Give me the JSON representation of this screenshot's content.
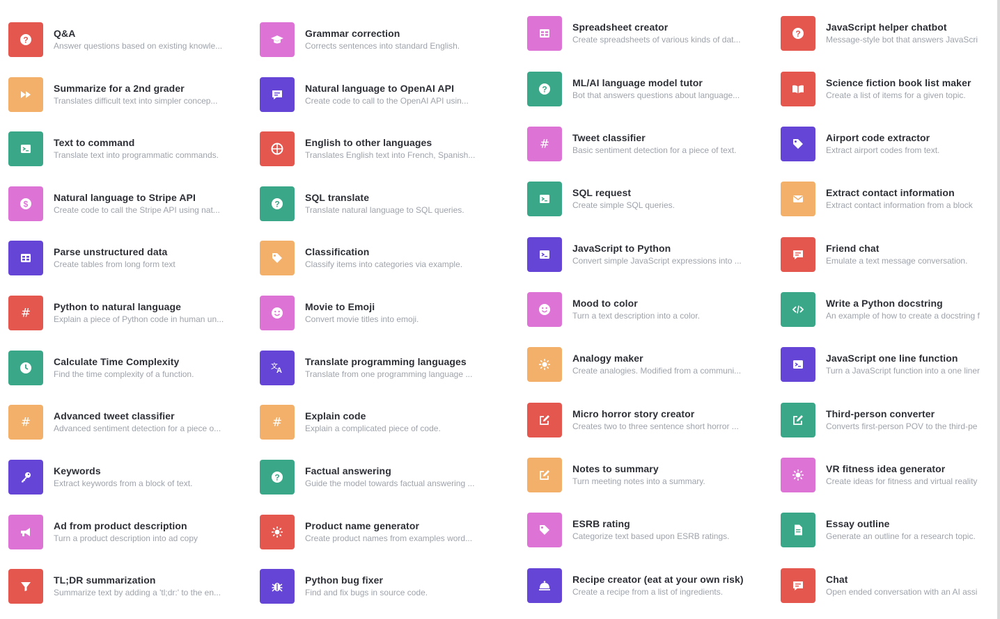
{
  "colors": {
    "red": "#e4574f",
    "orange": "#f2b06a",
    "teal": "#3aa888",
    "pink": "#de73d6",
    "purple": "#6445d6"
  },
  "columns": [
    {
      "items": [
        {
          "title": "Q&A",
          "desc": "Answer questions based on existing knowle...",
          "color": "red",
          "icon": "question-icon"
        },
        {
          "title": "Summarize for a 2nd grader",
          "desc": "Translates difficult text into simpler concep...",
          "color": "orange",
          "icon": "fast-forward-icon"
        },
        {
          "title": "Text to command",
          "desc": "Translate text into programmatic commands.",
          "color": "teal",
          "icon": "terminal-icon"
        },
        {
          "title": "Natural language to Stripe API",
          "desc": "Create code to call the Stripe API using nat...",
          "color": "pink",
          "icon": "dollar-icon"
        },
        {
          "title": "Parse unstructured data",
          "desc": "Create tables from long form text",
          "color": "purple",
          "icon": "table-icon"
        },
        {
          "title": "Python to natural language",
          "desc": "Explain a piece of Python code in human un...",
          "color": "red",
          "icon": "hash-icon"
        },
        {
          "title": "Calculate Time Complexity",
          "desc": "Find the time complexity of a function.",
          "color": "teal",
          "icon": "clock-icon"
        },
        {
          "title": "Advanced tweet classifier",
          "desc": "Advanced sentiment detection for a piece o...",
          "color": "orange",
          "icon": "hash-icon"
        },
        {
          "title": "Keywords",
          "desc": "Extract keywords from a block of text.",
          "color": "purple",
          "icon": "key-icon"
        },
        {
          "title": "Ad from product description",
          "desc": "Turn a product description into ad copy",
          "color": "pink",
          "icon": "megaphone-icon"
        },
        {
          "title": "TL;DR summarization",
          "desc": "Summarize text by adding a 'tl;dr:' to the en...",
          "color": "red",
          "icon": "funnel-icon"
        }
      ]
    },
    {
      "items": [
        {
          "title": "Grammar correction",
          "desc": "Corrects sentences into standard English.",
          "color": "pink",
          "icon": "graduation-cap-icon"
        },
        {
          "title": "Natural language to OpenAI API",
          "desc": "Create code to call to the OpenAI API usin...",
          "color": "purple",
          "icon": "chat-bubble-icon"
        },
        {
          "title": "English to other languages",
          "desc": "Translates English text into French, Spanish...",
          "color": "red",
          "icon": "globe-icon"
        },
        {
          "title": "SQL translate",
          "desc": "Translate natural language to SQL queries.",
          "color": "teal",
          "icon": "question-icon"
        },
        {
          "title": "Classification",
          "desc": "Classify items into categories via example.",
          "color": "orange",
          "icon": "tag-icon"
        },
        {
          "title": "Movie to Emoji",
          "desc": "Convert movie titles into emoji.",
          "color": "pink",
          "icon": "smiley-icon"
        },
        {
          "title": "Translate programming languages",
          "desc": "Translate from one programming language ...",
          "color": "purple",
          "icon": "translate-icon"
        },
        {
          "title": "Explain code",
          "desc": "Explain a complicated piece of code.",
          "color": "orange",
          "icon": "hash-icon"
        },
        {
          "title": "Factual answering",
          "desc": "Guide the model towards factual answering ...",
          "color": "teal",
          "icon": "question-icon"
        },
        {
          "title": "Product name generator",
          "desc": "Create product names from examples word...",
          "color": "red",
          "icon": "lightbulb-icon"
        },
        {
          "title": "Python bug fixer",
          "desc": "Find and fix bugs in source code.",
          "color": "purple",
          "icon": "bug-icon"
        }
      ]
    },
    {
      "items": [
        {
          "title": "Spreadsheet creator",
          "desc": "Create spreadsheets of various kinds of dat...",
          "color": "pink",
          "icon": "table-icon"
        },
        {
          "title": "ML/AI language model tutor",
          "desc": "Bot that answers questions about language...",
          "color": "teal",
          "icon": "question-icon"
        },
        {
          "title": "Tweet classifier",
          "desc": "Basic sentiment detection for a piece of text.",
          "color": "pink",
          "icon": "hash-icon"
        },
        {
          "title": "SQL request",
          "desc": "Create simple SQL queries.",
          "color": "teal",
          "icon": "terminal-icon"
        },
        {
          "title": "JavaScript to Python",
          "desc": "Convert simple JavaScript expressions into ...",
          "color": "purple",
          "icon": "terminal-icon"
        },
        {
          "title": "Mood to color",
          "desc": "Turn a text description into a color.",
          "color": "pink",
          "icon": "smiley-icon"
        },
        {
          "title": "Analogy maker",
          "desc": "Create analogies. Modified from a communi...",
          "color": "orange",
          "icon": "lightbulb-icon"
        },
        {
          "title": "Micro horror story creator",
          "desc": "Creates two to three sentence short horror ...",
          "color": "red",
          "icon": "edit-icon"
        },
        {
          "title": "Notes to summary",
          "desc": "Turn meeting notes into a summary.",
          "color": "orange",
          "icon": "edit-icon"
        },
        {
          "title": "ESRB rating",
          "desc": "Categorize text based upon ESRB ratings.",
          "color": "pink",
          "icon": "tag-icon"
        },
        {
          "title": "Recipe creator (eat at your own risk)",
          "desc": "Create a recipe from a list of ingredients.",
          "color": "purple",
          "icon": "cloche-icon"
        }
      ]
    },
    {
      "items": [
        {
          "title": "JavaScript helper chatbot",
          "desc": "Message-style bot that answers JavaScri",
          "color": "red",
          "icon": "question-icon"
        },
        {
          "title": "Science fiction book list maker",
          "desc": "Create a list of items for a given topic.",
          "color": "red",
          "icon": "book-icon"
        },
        {
          "title": "Airport code extractor",
          "desc": "Extract airport codes from text.",
          "color": "purple",
          "icon": "tag-icon"
        },
        {
          "title": "Extract contact information",
          "desc": "Extract contact information from a block",
          "color": "orange",
          "icon": "envelope-icon"
        },
        {
          "title": "Friend chat",
          "desc": "Emulate a text message conversation.",
          "color": "red",
          "icon": "chat-bubble-icon"
        },
        {
          "title": "Write a Python docstring",
          "desc": "An example of how to create a docstring f",
          "color": "teal",
          "icon": "code-icon"
        },
        {
          "title": "JavaScript one line function",
          "desc": "Turn a JavaScript function into a one liner",
          "color": "purple",
          "icon": "terminal-icon"
        },
        {
          "title": "Third-person converter",
          "desc": "Converts first-person POV to the third-pe",
          "color": "teal",
          "icon": "edit-icon"
        },
        {
          "title": "VR fitness idea generator",
          "desc": "Create ideas for fitness and virtual reality",
          "color": "pink",
          "icon": "lightbulb-icon"
        },
        {
          "title": "Essay outline",
          "desc": "Generate an outline for a research topic.",
          "color": "teal",
          "icon": "document-icon"
        },
        {
          "title": "Chat",
          "desc": "Open ended conversation with an AI assi",
          "color": "red",
          "icon": "chat-bubble-icon"
        }
      ]
    }
  ]
}
